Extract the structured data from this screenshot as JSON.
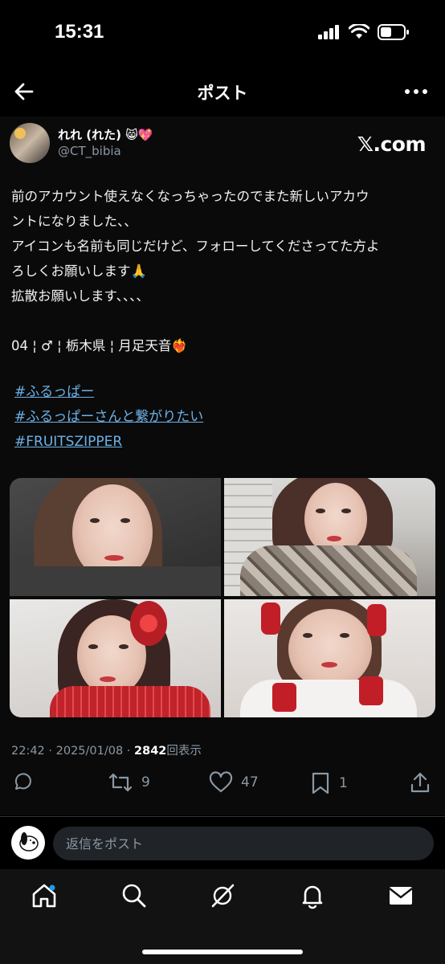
{
  "status_bar": {
    "time": "15:31"
  },
  "header": {
    "title": "ポスト"
  },
  "author": {
    "name": "れれ (れた) 😸💖",
    "handle": "@CT_bibia",
    "source_badge": "𝕏.com"
  },
  "tweet": {
    "lines": [
      "前のアカウント使えなくなっちゃったのでまた新しいアカウ",
      "ントになりました、、",
      "アイコンも名前も同じだけど、フォローしてくださってた方よ",
      "ろしくお願いします🙏",
      "拡散お願いします、、、、",
      "",
      "04 ¦ ♂ ¦ 栃木県 ¦ 月足天音❤️‍🔥"
    ],
    "hashtags": [
      "#ふるっぱー",
      "#ふるっぱーさんと繋がりたい",
      "#FRUITSZIPPER"
    ]
  },
  "meta": {
    "time_date": "22:42 · 2025/01/08 · ",
    "views": "2842",
    "views_label": "回表示"
  },
  "actions": {
    "reply": "",
    "retweet": "9",
    "like": "47",
    "bookmark": "1"
  },
  "reply": {
    "placeholder": "返信をポスト"
  },
  "icons": [
    "back-arrow-icon",
    "more-icon",
    "reply-icon",
    "retweet-icon",
    "like-icon",
    "bookmark-icon",
    "share-icon",
    "home-icon",
    "search-icon",
    "grok-icon",
    "notifications-icon",
    "messages-icon"
  ]
}
